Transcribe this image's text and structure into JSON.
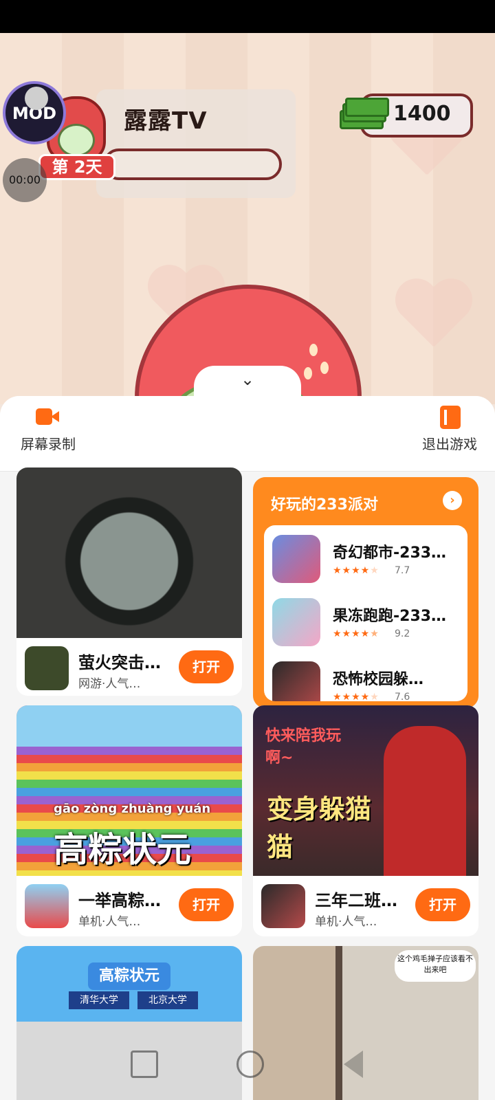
{
  "game": {
    "title": "露露TV",
    "day_label": "第 2天",
    "mod_label": "MOD",
    "timer": "00:00",
    "coins": "1400"
  },
  "sheet": {
    "toolbar": {
      "record_label": "屏幕录制",
      "exit_label": "退出游戏"
    },
    "party": {
      "title": "好玩的233派对",
      "items": [
        {
          "name": "奇幻都市-233…",
          "rating": "7.7"
        },
        {
          "name": "果冻跑跑-233…",
          "rating": "9.2"
        },
        {
          "name": "恐怖校园躲…",
          "rating": "7.6"
        }
      ]
    },
    "cards": [
      {
        "title": "萤火突击…",
        "subtitle": "网游·人气…",
        "button": "打开"
      },
      {
        "title": "一举高粽…",
        "subtitle": "单机·人气…",
        "button": "打开"
      },
      {
        "title": "三年二班…",
        "subtitle": "单机·人气…",
        "button": "打开"
      }
    ],
    "banners": {
      "card2_pinyin": "gāo zòng zhuàng yuán",
      "card2_text": "高粽状元",
      "card3_text1": "快来陪我玩啊~",
      "card3_text2": "变身躲猫猫",
      "card4_title": "高粽状元",
      "card4_left": "清华大学",
      "card4_right": "北京大学",
      "card5_bubble": "这个鸡毛掸子应该看不出来吧"
    }
  },
  "colors": {
    "accent": "#ff6a13",
    "party_bg": "#ff8a1e"
  }
}
